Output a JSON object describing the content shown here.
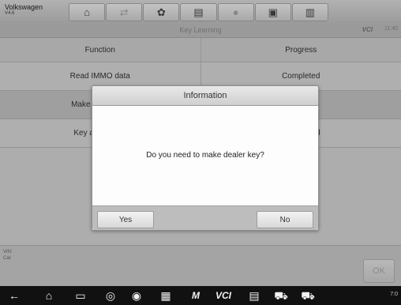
{
  "app": {
    "name": "Volkswagen",
    "version": "V4.6"
  },
  "toolbar": {
    "buttons": [
      {
        "icon": "home-icon",
        "glyph": "⌂"
      },
      {
        "icon": "vehicle-swap-icon",
        "glyph": "⇄"
      },
      {
        "icon": "settings-icon",
        "glyph": "✿"
      },
      {
        "icon": "print-icon",
        "glyph": "▤"
      },
      {
        "icon": "help-icon",
        "glyph": "●"
      },
      {
        "icon": "save-icon",
        "glyph": "▣"
      },
      {
        "icon": "datalog-icon",
        "glyph": "▥"
      }
    ]
  },
  "subbar": {
    "title": "Key Learning",
    "vci": "VCI",
    "clock": "11:40"
  },
  "table": {
    "headers": [
      "Function",
      "Progress"
    ],
    "rows": [
      [
        "Read IMMO data",
        "Completed"
      ],
      [
        "Make dealer key",
        ""
      ],
      [
        "Key adaptation",
        "Not started"
      ]
    ]
  },
  "footer": {
    "vin_label": "VIN:",
    "cal_label": "Cal:",
    "ok_label": "OK"
  },
  "dialog": {
    "title": "Information",
    "message": "Do you need to make dealer key?",
    "yes_label": "Yes",
    "no_label": "No"
  },
  "navbar": {
    "items": [
      {
        "icon": "back-icon",
        "glyph": "←"
      },
      {
        "icon": "home-icon",
        "glyph": "⌂"
      },
      {
        "icon": "recent-apps-icon",
        "glyph": "▭"
      },
      {
        "icon": "browser-icon",
        "glyph": "◎"
      },
      {
        "icon": "camera-icon",
        "glyph": "◉"
      },
      {
        "icon": "display-icon",
        "glyph": "▦"
      },
      {
        "icon": "maxisys-icon",
        "glyph": "M"
      },
      {
        "icon": "vci-icon",
        "glyph": "VCI"
      },
      {
        "icon": "vehicle-info-icon",
        "glyph": "▤"
      },
      {
        "icon": "car-icon",
        "glyph": "⛟"
      },
      {
        "icon": "vehicle-list-icon",
        "glyph": "⛟"
      }
    ],
    "status": "7:0"
  }
}
